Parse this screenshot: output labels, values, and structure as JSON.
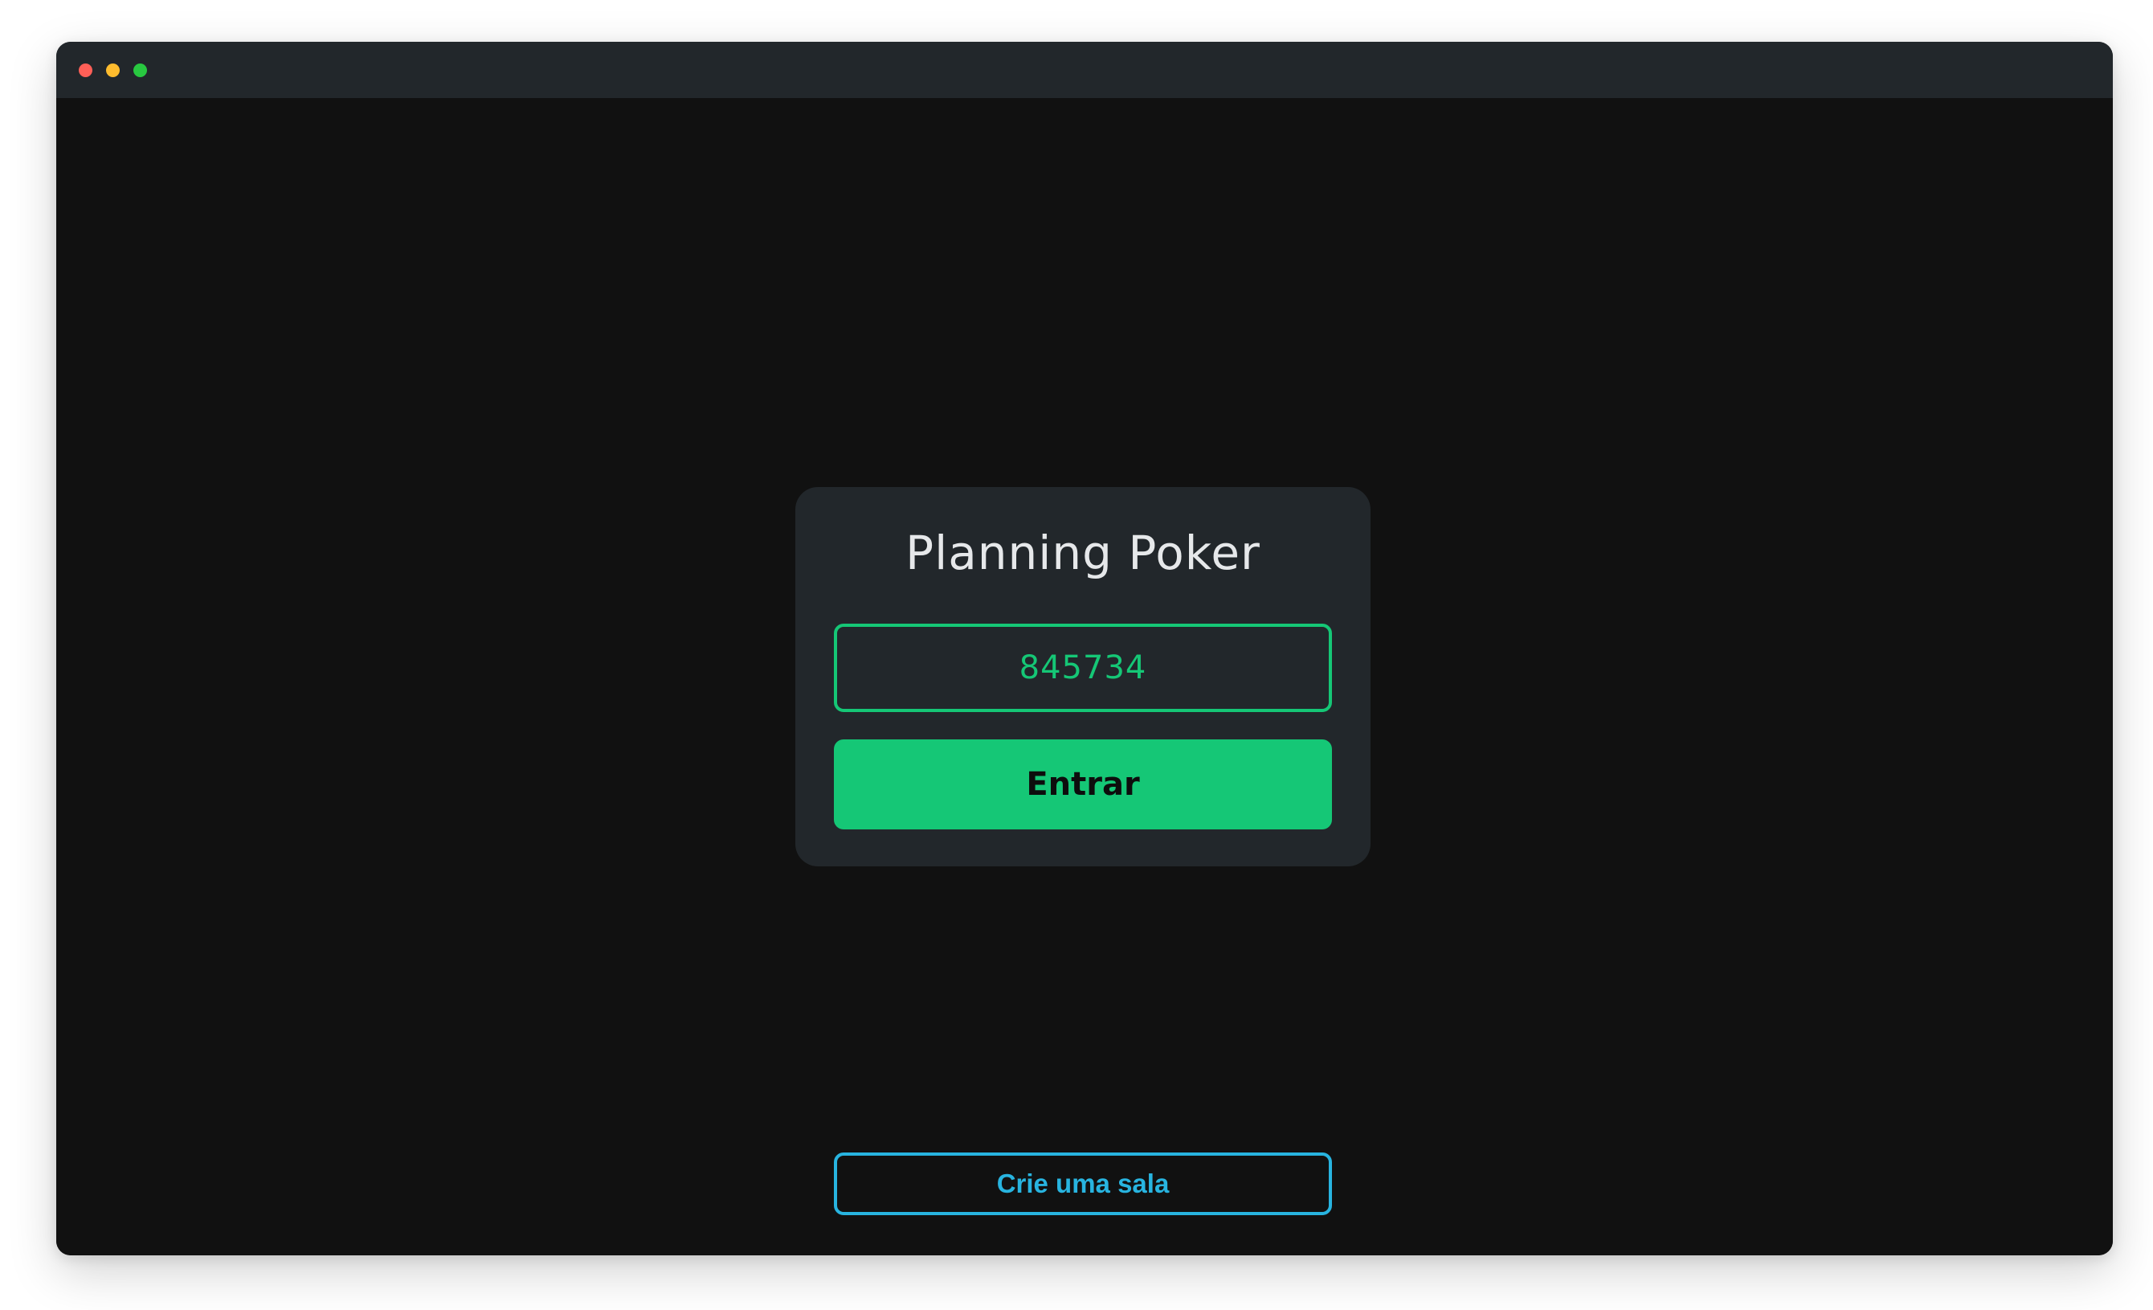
{
  "window": {
    "controls": {
      "close_color": "#ff5f57",
      "minimize_color": "#febc2e",
      "maximize_color": "#28c840"
    }
  },
  "theme": {
    "background": "#111111",
    "card_background": "#22272b",
    "accent_green": "#15c776",
    "accent_blue": "#28b4e0"
  },
  "card": {
    "title": "Planning Poker",
    "room_input": {
      "value": "845734",
      "placeholder": ""
    },
    "enter_button_label": "Entrar"
  },
  "footer": {
    "create_room_label": "Crie uma sala"
  }
}
